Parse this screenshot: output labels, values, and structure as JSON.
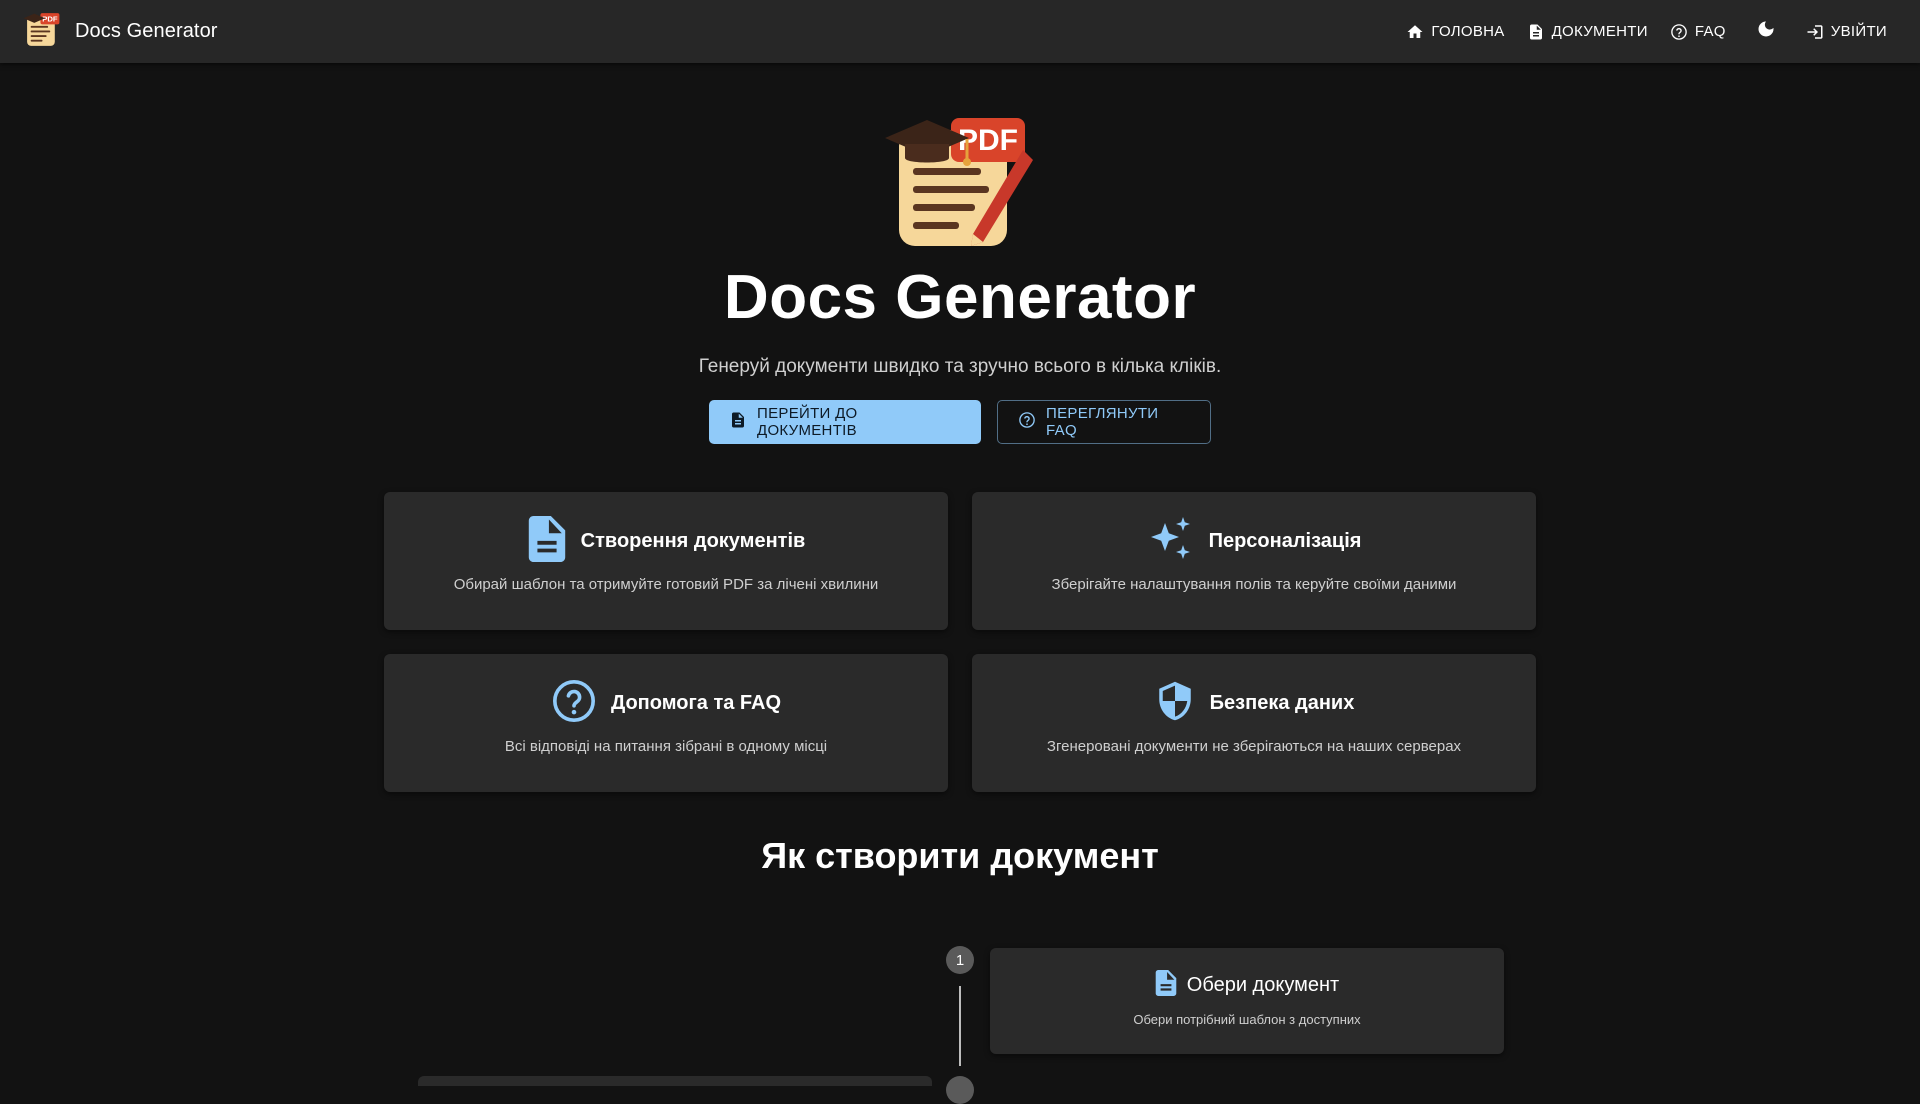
{
  "app": {
    "title": "Docs Generator",
    "logo_icon": "pdf-document-logo-icon",
    "accent_color": "#90caf9"
  },
  "nav": {
    "items": [
      {
        "label": "ГОЛОВНА",
        "icon": "home-icon"
      },
      {
        "label": "ДОКУМЕНТИ",
        "icon": "document-icon"
      },
      {
        "label": "FAQ",
        "icon": "help-circle-icon"
      }
    ],
    "theme_toggle_icon": "moon-icon",
    "login": {
      "label": "УВІЙТИ",
      "icon": "login-icon"
    }
  },
  "hero": {
    "logo_icon": "pdf-document-logo-icon",
    "title": "Docs Generator",
    "subtitle": "Генеруй документи швидко та зручно всього в кілька кліків.",
    "primary_button": {
      "label": "ПЕРЕЙТИ ДО ДОКУМЕНТІВ",
      "icon": "document-icon"
    },
    "secondary_button": {
      "label": "ПЕРЕГЛЯНУТИ FAQ",
      "icon": "help-circle-icon"
    }
  },
  "features": [
    {
      "title": "Створення документів",
      "description": "Обирай шаблон та отримуйте готовий PDF за лічені хвилини",
      "icon": "document-icon"
    },
    {
      "title": "Персоналізація",
      "description": "Зберігайте налаштування полів та керуйте своїми даними",
      "icon": "sparkles-icon"
    },
    {
      "title": "Допомога та FAQ",
      "description": "Всі відповіді на питання зібрані в одному місці",
      "icon": "help-circle-icon"
    },
    {
      "title": "Безпека даних",
      "description": "Згенеровані документи не зберігаються на наших серверах",
      "icon": "shield-icon"
    }
  ],
  "how_to": {
    "title": "Як створити документ",
    "steps": [
      {
        "number": "1",
        "title": "Обери документ",
        "description": "Обери потрібний шаблон з доступних",
        "icon": "document-icon"
      }
    ]
  }
}
